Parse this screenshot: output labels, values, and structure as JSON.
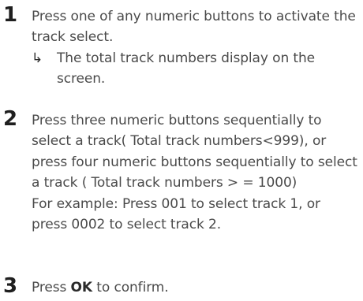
{
  "steps": [
    {
      "number": "1",
      "text": "Press one of any numeric buttons to activate the track select.",
      "result_icon": "result-arrow-icon",
      "result_symbol": "↳",
      "result": "The total track numbers display on the screen."
    },
    {
      "number": "2",
      "text": "Press three numeric buttons sequentially to select a track( Total track numbers<999), or press four numeric buttons sequentially to select a track ( Total track numbers > = 1000)",
      "example": "For example: Press 001 to select track 1, or press 0002 to select track 2."
    },
    {
      "number": "3",
      "text_before": "Press ",
      "keyword": "OK",
      "text_after": " to confirm."
    }
  ]
}
